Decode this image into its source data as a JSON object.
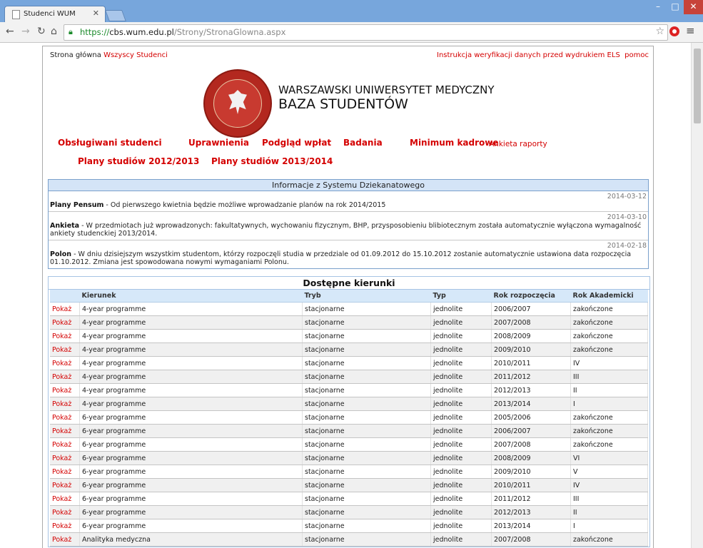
{
  "browser": {
    "tab_title": "Studenci WUM",
    "url_scheme": "https://",
    "url_host": "cbs.wum.edu.pl",
    "url_path": "/Strony/StronaGlowna.aspx"
  },
  "header": {
    "home_label": "Strona główna",
    "all_students": "Wszyscy Studenci",
    "instructions": "Instrukcja weryfikacji danych przed wydrukiem ELS",
    "help": "pomoc",
    "university": "WARSZAWSKI UNIWERSYTET MEDYCZNY",
    "database": "BAZA STUDENTÓW"
  },
  "menu": {
    "served": "Obsługiwani studenci",
    "permissions": "Uprawnienia",
    "payments": "Podgląd wpłat",
    "exams": "Badania",
    "minimum": "Minimum kadrowe",
    "survey_reports": "Ankieta raporty",
    "plans_2012": "Plany studiów 2012/2013",
    "plans_2013": "Plany studiów 2013/2014"
  },
  "info": {
    "title": "Informacje z Systemu Dziekanatowego",
    "items": [
      {
        "date": "2014-03-12",
        "head": "Plany Pensum",
        "text": " - Od pierwszego kwietnia będzie możliwe wprowadzanie planów na rok 2014/2015"
      },
      {
        "date": "2014-03-10",
        "head": "Ankieta",
        "text": " - W przedmiotach już wprowadzonych: fakultatywnych, wychowaniu fizycznym, BHP, przysposobieniu blibiotecznym została automatycznie wyłączona wymagalność ankiety studenckiej 2013/2014."
      },
      {
        "date": "2014-02-18",
        "head": "Polon",
        "text": " - W dniu dzisiejszym wszystkim studentom, którzy rozpoczęli studia w przedziale od 01.09.2012 do 15.10.2012 zostanie automatycznie ustawiona data rozpoczęcia 01.10.2012. Zmiana jest spowodowana nowymi wymaganiami Polonu."
      }
    ]
  },
  "table": {
    "title": "Dostępne kierunki",
    "headers": [
      "",
      "Kierunek",
      "Tryb",
      "Typ",
      "Rok rozpoczęcia",
      "Rok Akademicki"
    ],
    "link_label": "Pokaż",
    "rows": [
      [
        "4-year programme",
        "stacjonarne",
        "jednolite",
        "2006/2007",
        "zakończone"
      ],
      [
        "4-year programme",
        "stacjonarne",
        "jednolite",
        "2007/2008",
        "zakończone"
      ],
      [
        "4-year programme",
        "stacjonarne",
        "jednolite",
        "2008/2009",
        "zakończone"
      ],
      [
        "4-year programme",
        "stacjonarne",
        "jednolite",
        "2009/2010",
        "zakończone"
      ],
      [
        "4-year programme",
        "stacjonarne",
        "jednolite",
        "2010/2011",
        "IV"
      ],
      [
        "4-year programme",
        "stacjonarne",
        "jednolite",
        "2011/2012",
        "III"
      ],
      [
        "4-year programme",
        "stacjonarne",
        "jednolite",
        "2012/2013",
        "II"
      ],
      [
        "4-year programme",
        "stacjonarne",
        "jednolite",
        "2013/2014",
        "I"
      ],
      [
        "6-year programme",
        "stacjonarne",
        "jednolite",
        "2005/2006",
        "zakończone"
      ],
      [
        "6-year programme",
        "stacjonarne",
        "jednolite",
        "2006/2007",
        "zakończone"
      ],
      [
        "6-year programme",
        "stacjonarne",
        "jednolite",
        "2007/2008",
        "zakończone"
      ],
      [
        "6-year programme",
        "stacjonarne",
        "jednolite",
        "2008/2009",
        "VI"
      ],
      [
        "6-year programme",
        "stacjonarne",
        "jednolite",
        "2009/2010",
        "V"
      ],
      [
        "6-year programme",
        "stacjonarne",
        "jednolite",
        "2010/2011",
        "IV"
      ],
      [
        "6-year programme",
        "stacjonarne",
        "jednolite",
        "2011/2012",
        "III"
      ],
      [
        "6-year programme",
        "stacjonarne",
        "jednolite",
        "2012/2013",
        "II"
      ],
      [
        "6-year programme",
        "stacjonarne",
        "jednolite",
        "2013/2014",
        "I"
      ],
      [
        "Analityka medyczna",
        "stacjonarne",
        "jednolite",
        "2007/2008",
        "zakończone"
      ]
    ]
  },
  "icons": {
    "back": "back-arrow-icon",
    "forward": "forward-arrow-icon",
    "reload": "reload-icon",
    "home": "home-icon",
    "lock": "lock-icon",
    "star": "star-icon",
    "menu": "hamburger-menu-icon"
  },
  "colors": {
    "link_red": "#d40000",
    "header_blue": "#d4e4f7"
  }
}
